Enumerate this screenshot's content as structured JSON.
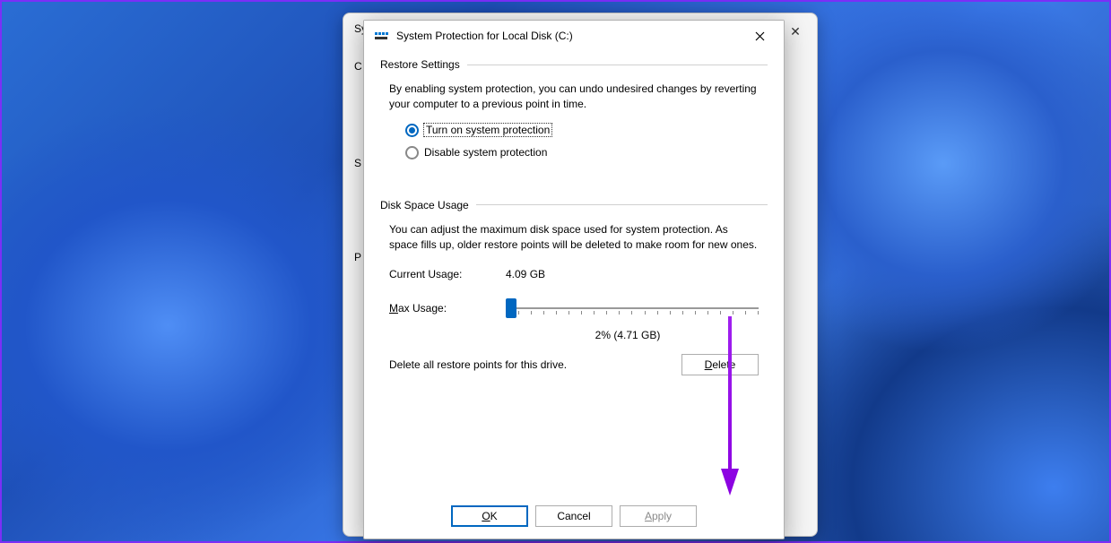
{
  "back_window": {
    "title_fragment_top": "Sy",
    "line_c": "C",
    "line_s": "S",
    "line_p": "P"
  },
  "dialog": {
    "title": "System Protection for Local Disk (C:)",
    "restore_settings": {
      "label": "Restore Settings",
      "description": "By enabling system protection, you can undo undesired changes by reverting your computer to a previous point in time.",
      "radio_on": "Turn on system protection",
      "radio_off": "Disable system protection",
      "selected": "on"
    },
    "disk_usage": {
      "label": "Disk Space Usage",
      "description": "You can adjust the maximum disk space used for system protection. As space fills up, older restore points will be deleted to make room for new ones.",
      "current_usage_label": "Current Usage:",
      "current_usage_value": "4.09 GB",
      "max_usage_label_prefix": "M",
      "max_usage_label_rest": "ax Usage:",
      "slider_percent": 2,
      "slider_display": "2% (4.71 GB)"
    },
    "delete": {
      "text": "Delete all restore points for this drive.",
      "button_prefix": "D",
      "button_rest": "elete"
    },
    "footer": {
      "ok_prefix": "O",
      "ok_rest": "K",
      "cancel": "Cancel",
      "apply_prefix": "A",
      "apply_rest": "pply"
    }
  }
}
